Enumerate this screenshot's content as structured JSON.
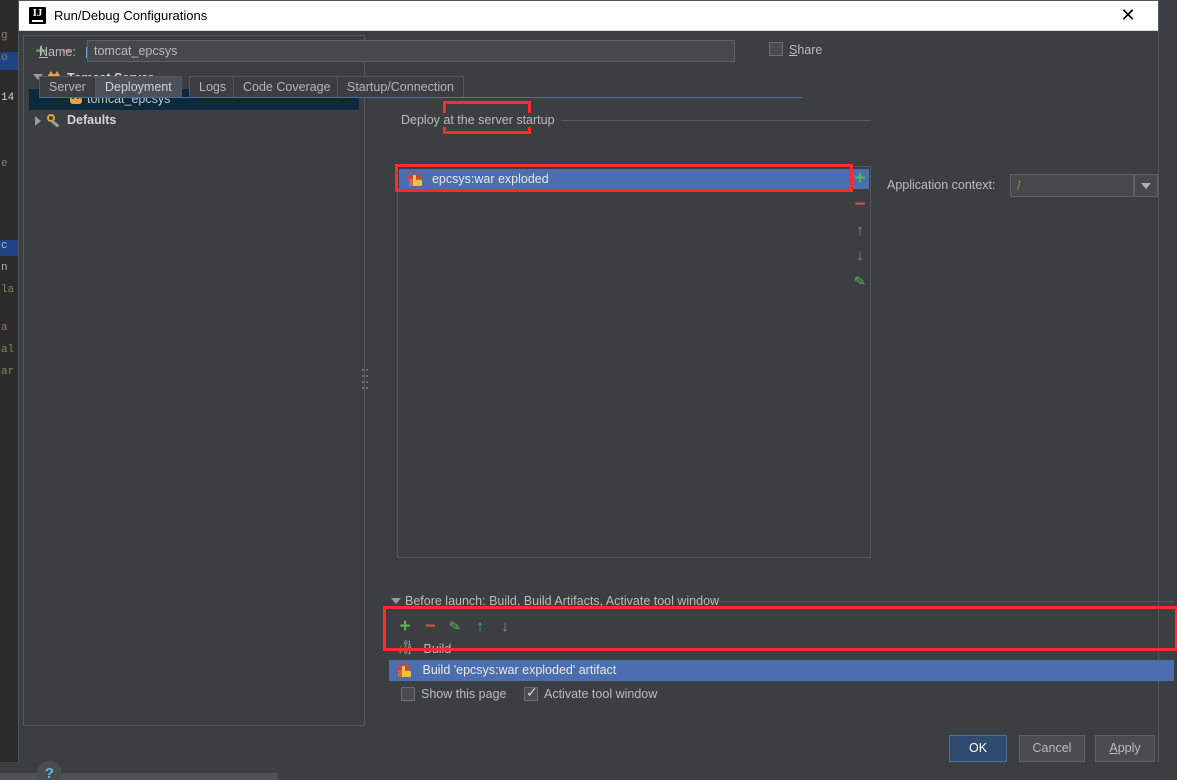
{
  "window": {
    "title": "Run/Debug Configurations",
    "app_icon": "intellij-idea-icon",
    "close_label": "✕"
  },
  "left_panel": {
    "toolbar": [
      {
        "name": "add-configuration-button",
        "glyph": "+",
        "kind": "plus"
      },
      {
        "name": "remove-configuration-button",
        "glyph": "−",
        "kind": "minus"
      },
      {
        "name": "copy-configuration-button",
        "glyph": "",
        "kind": "copy"
      },
      {
        "name": "edit-defaults-button",
        "glyph": "",
        "kind": "wrench"
      },
      {
        "name": "move-up-button",
        "glyph": "↑",
        "kind": "gray"
      },
      {
        "name": "move-down-button",
        "glyph": "↓",
        "kind": "gray"
      },
      {
        "name": "move-into-folder-button",
        "glyph": "",
        "kind": "folder"
      },
      {
        "name": "sort-configurations-button",
        "glyph": "↓ᵃᶻ",
        "kind": "sort"
      }
    ],
    "tree": [
      {
        "label": "Tomcat Server",
        "icon": "tomcat-icon",
        "expanded": true,
        "bold": true,
        "selected": false,
        "indent": 0
      },
      {
        "label": "tomcat_epcsys",
        "icon": "tomcat-icon",
        "expanded": null,
        "bold": false,
        "selected": true,
        "indent": 1
      },
      {
        "label": "Defaults",
        "icon": "wrench-icon",
        "expanded": false,
        "bold": true,
        "selected": false,
        "indent": 0
      }
    ]
  },
  "form": {
    "name_label": "Name:",
    "name_label_mnemonic": "N",
    "name_value": "tomcat_epcsys",
    "name_placeholder": "",
    "share_label": "Share",
    "share_label_mnemonic": "S",
    "share_checked": false
  },
  "tabs": [
    {
      "label": "Server",
      "active": false
    },
    {
      "label": "Deployment",
      "active": true,
      "highlighted": true
    },
    {
      "label": "Logs",
      "active": false
    },
    {
      "label": "Code Coverage",
      "active": false
    },
    {
      "label": "Startup/Connection",
      "active": false
    }
  ],
  "deployment": {
    "group_title": "Deploy at the server startup",
    "items": [
      {
        "label": "epcsys:war exploded",
        "icon": "artifact-icon",
        "selected": true,
        "highlighted": true
      }
    ],
    "side_tools": [
      {
        "name": "add-artifact-button",
        "glyph": "+",
        "kind": "plus"
      },
      {
        "name": "remove-artifact-button",
        "glyph": "−",
        "kind": "minus"
      },
      {
        "name": "move-artifact-up-button",
        "glyph": "↑",
        "kind": "gray"
      },
      {
        "name": "move-artifact-down-button",
        "glyph": "↓",
        "kind": "gray"
      },
      {
        "name": "edit-artifact-button",
        "glyph": "✎",
        "kind": "pencil"
      }
    ],
    "application_context_label": "Application context:",
    "application_context_value": "/"
  },
  "before_launch": {
    "title": "Before launch: Build, Build Artifacts, Activate tool window",
    "title_mnemonic": "B",
    "expanded": true,
    "toolbar": [
      {
        "name": "add-before-launch-task-button",
        "glyph": "+",
        "kind": "plus"
      },
      {
        "name": "remove-before-launch-task-button",
        "glyph": "−",
        "kind": "minus"
      },
      {
        "name": "edit-before-launch-task-button",
        "glyph": "✎",
        "kind": "pencil"
      },
      {
        "name": "move-task-up-button",
        "glyph": "↑",
        "kind": "blue"
      },
      {
        "name": "move-task-down-button",
        "glyph": "↓",
        "kind": "gray"
      }
    ],
    "tasks": [
      {
        "label": "Build",
        "icon": "build-icon",
        "selected": false
      },
      {
        "label": "Build 'epcsys:war exploded' artifact",
        "icon": "artifact-icon",
        "selected": true
      }
    ],
    "highlighted": true,
    "options": [
      {
        "name": "show-this-page-checkbox",
        "label": "Show this page",
        "checked": false
      },
      {
        "name": "activate-tool-window-checkbox",
        "label": "Activate tool window",
        "checked": true
      }
    ]
  },
  "footer": {
    "help_glyph": "?",
    "ok_label": "OK",
    "cancel_label": "Cancel",
    "apply_label": "Apply",
    "apply_mnemonic": "A"
  },
  "colors": {
    "dialog_bg": "#3c3f41",
    "selection_blue": "#4b6eaf",
    "tree_selection": "#0d293e",
    "highlight_red": "#ff2a2a",
    "accent_green": "#5ab55a",
    "accent_orange": "#cc7832"
  },
  "background_editor": {
    "gutter_fragments": [
      "g",
      "o",
      "14",
      "e",
      "c",
      "n",
      "la",
      "a",
      "al",
      "ar"
    ]
  }
}
